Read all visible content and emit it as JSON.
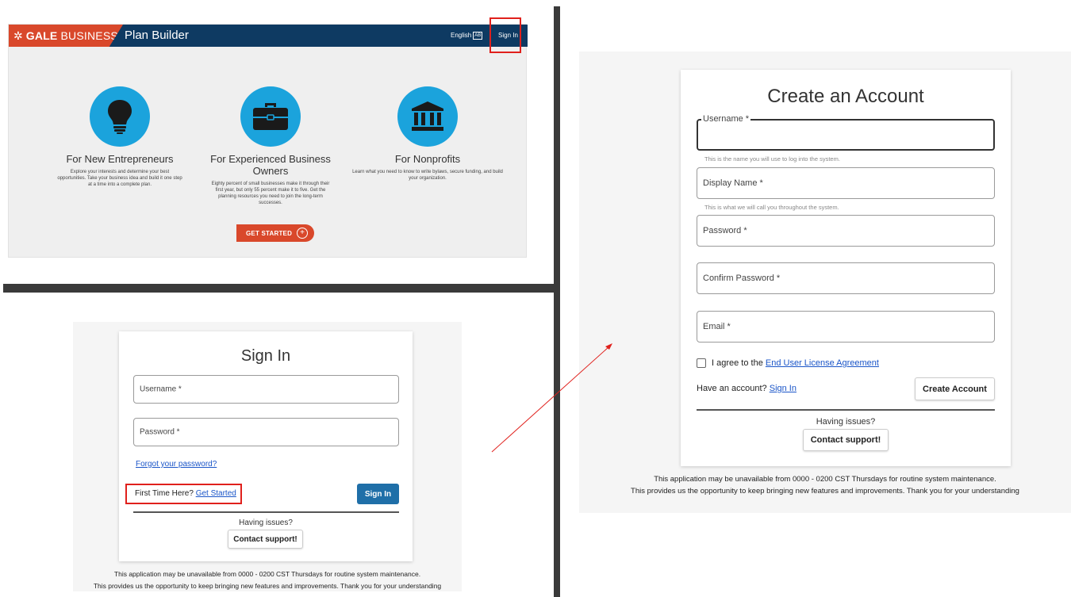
{
  "landing": {
    "brand_mark": "✲",
    "brand_bold": "GALE ",
    "brand_light": "BUSINESS",
    "app_title": "Plan Builder",
    "language_label": "English",
    "language_badge": "AB",
    "sign_in_label": "Sign In",
    "features": [
      {
        "title": "For New Entrepreneurs",
        "description": "Explore your interests and determine your best opportunities. Take your business idea and build it one step at a time into a complete plan.",
        "icon": "lightbulb-icon"
      },
      {
        "title": "For Experienced Business Owners",
        "description": "Eighty percent of small businesses make it through their first year, but only 55 percent make it to five. Get the planning resources you need to join the long-term successes.",
        "icon": "briefcase-icon"
      },
      {
        "title": "For Nonprofits",
        "description": "Learn what you need to know to write bylaws, secure funding, and build your organization.",
        "icon": "institution-icon"
      }
    ],
    "get_started_label": "GET STARTED",
    "get_started_icon": "plus-circle-icon"
  },
  "signin": {
    "title": "Sign In",
    "username_placeholder": "Username *",
    "password_placeholder": "Password *",
    "forgot_label": "Forgot your password?",
    "first_time_text": "First Time Here?",
    "get_started_link": "Get Started",
    "sign_in_button": "Sign In",
    "having_issues": "Having issues?",
    "contact_support": "Contact support!",
    "notice_line1": "This application may be unavailable from 0000 - 0200 CST Thursdays for routine system maintenance.",
    "notice_line2": "This provides us the opportunity to keep bringing new features and improvements. Thank you for your understanding"
  },
  "create": {
    "title": "Create an Account",
    "username_label": "Username *",
    "username_hint": "This is the name you will use to log into the system.",
    "display_placeholder": "Display Name *",
    "display_hint": "This is what we will call you throughout the system.",
    "password_placeholder": "Password *",
    "confirm_placeholder": "Confirm Password *",
    "email_placeholder": "Email *",
    "agree_text": "I agree to the",
    "eula_link": "End User License Agreement",
    "have_account_text": "Have an account?",
    "sign_in_link": "Sign In",
    "create_button": "Create Account",
    "having_issues": "Having issues?",
    "contact_support": "Contact support!",
    "notice_line1": "This application may be unavailable from 0000 - 0200 CST Thursdays for routine system maintenance.",
    "notice_line2": "This provides us the opportunity to keep bringing new features and improvements. Thank you for your understanding"
  },
  "colors": {
    "header_navy": "#0e3a62",
    "brand_orange": "#d9482b",
    "feature_blue": "#1ba3dc",
    "button_blue": "#1f6fa8",
    "highlight_red": "#e0201c",
    "link_blue": "#1a55c8"
  }
}
